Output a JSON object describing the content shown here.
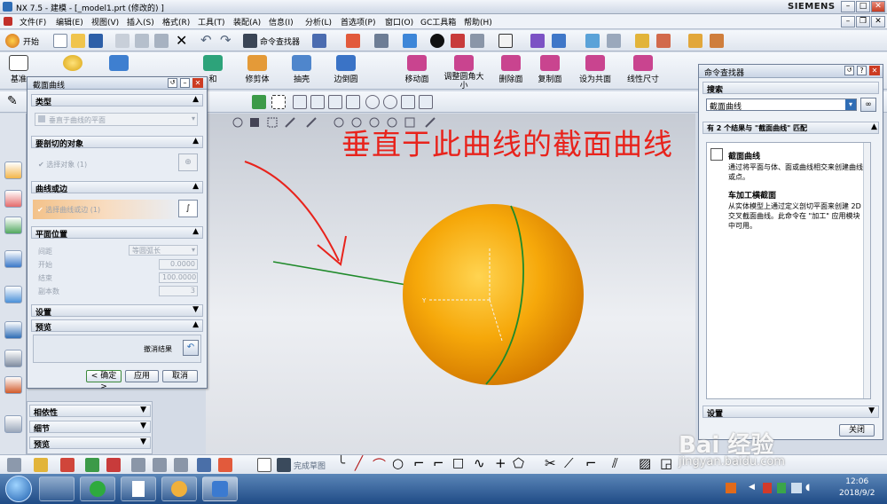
{
  "window": {
    "title": "NX 7.5 - 建模 - [_model1.prt (修改的) ]",
    "brand": "SIEMENS"
  },
  "menu": [
    "文件(F)",
    "编辑(E)",
    "视图(V)",
    "插入(S)",
    "格式(R)",
    "工具(T)",
    "装配(A)",
    "信息(I)",
    "分析(L)",
    "首选项(P)",
    "窗口(O)",
    "GC工具箱",
    "帮助(H)"
  ],
  "toolbar1": {
    "start_label": "开始",
    "command_finder_label": "命令查找器"
  },
  "toolbar2": {
    "commands": [
      "基准",
      "和",
      "修剪体",
      "抽壳",
      "边倒圆",
      "移动面",
      "调整圆角大小",
      "删除面",
      "复制面",
      "设为共面",
      "线性尺寸"
    ]
  },
  "bottom_toolbar": {
    "finish_sketch_label": "完成草图"
  },
  "dialog": {
    "title": "截面曲线",
    "type_section": "类型",
    "type_value": "垂直于曲线的平面",
    "objects_section": "要剖切的对象",
    "select_object": "选择对象 (1)",
    "curve_section": "曲线或边",
    "select_curve": "选择曲线或边 (1)",
    "plane_section": "平面位置",
    "spacing_label": "间距",
    "spacing_value": "等圆弧长",
    "start_label": "开始",
    "start_value": "0.0000",
    "end_label": "结束",
    "end_value": "100.0000",
    "copies_label": "副本数",
    "copies_value": "3",
    "settings_section": "设置",
    "preview_section": "预览",
    "undo_result": "撤消结果",
    "ok": "< 确定 >",
    "apply": "应用",
    "cancel": "取消"
  },
  "navigator_rows": [
    "相依性",
    "细节",
    "预览"
  ],
  "finder": {
    "title": "命令查找器",
    "search_section": "搜索",
    "search_value": "截面曲线",
    "results_prefix": "有 2 个结果与 \"截面曲线\" 匹配",
    "result1_title": "截面曲线",
    "result1_desc": "通过将平面与体、面或曲线相交来创建曲线或点。",
    "result2_title": "车加工横截面",
    "result2_desc": "从实体模型上通过定义剖切平面来创建 2D 交叉截面曲线。此命令在 \"加工\" 应用模块中可用。",
    "settings_section": "设置",
    "close_label": "关闭"
  },
  "annotation": "垂直于此曲线的截面曲线",
  "watermark": {
    "brand": "Bai 经验",
    "url": "jingyan.baidu.com"
  },
  "taskbar": {
    "time": "12:06",
    "date": "2018/9/2"
  },
  "colors": {
    "annotation": "#e8231c",
    "sphere": "#f5a40a",
    "curve": "#1f8a2a",
    "arrow": "#e8231c"
  }
}
